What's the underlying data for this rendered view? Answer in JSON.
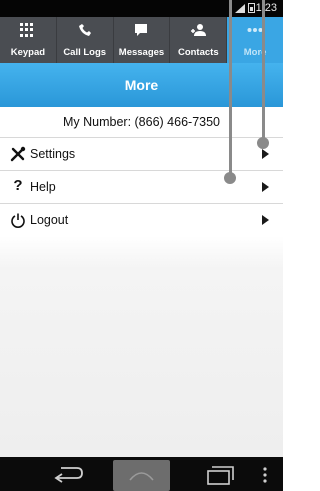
{
  "status": {
    "time": "1:23"
  },
  "tabs": [
    {
      "label": "Keypad",
      "icon": "keypad-grid-icon"
    },
    {
      "label": "Call Logs",
      "icon": "phone-icon"
    },
    {
      "label": "Messages",
      "icon": "chat-bubble-icon"
    },
    {
      "label": "Contacts",
      "icon": "contacts-icon"
    },
    {
      "label": "More",
      "icon": "more-dots-icon",
      "active": true
    }
  ],
  "header": {
    "title": "More"
  },
  "my_number": "My Number: (866) 466-7350",
  "menu": [
    {
      "label": "Settings",
      "icon": "tools-icon"
    },
    {
      "label": "Help",
      "icon": "question-mark-icon"
    },
    {
      "label": "Logout",
      "icon": "power-icon"
    }
  ],
  "colors": {
    "tabbar": "#4a4d52",
    "accent": "#2f9fe1",
    "navbar": "#0b0b0b"
  }
}
